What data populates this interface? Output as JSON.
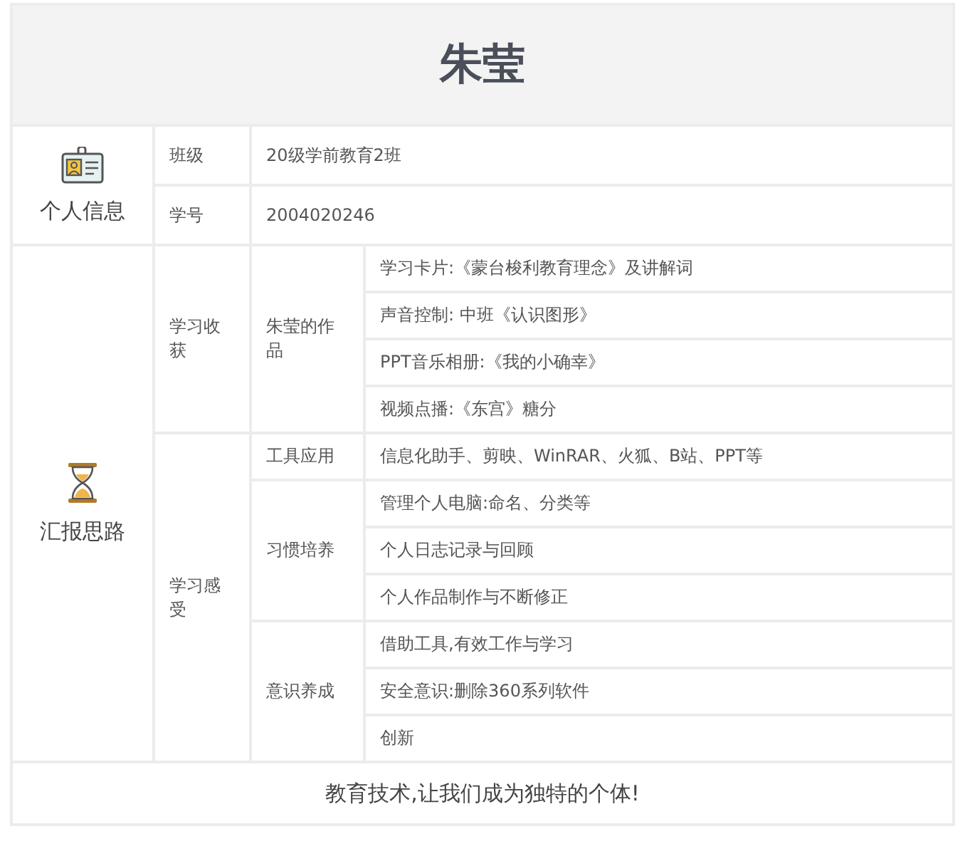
{
  "title": "朱莹",
  "sections": [
    {
      "kind": "info",
      "label": "个人信息",
      "rows": [
        {
          "label": "班级",
          "value": "20级学前教育2班"
        },
        {
          "label": "学号",
          "value": "2004020246"
        }
      ]
    },
    {
      "kind": "outline",
      "label": "汇报思路",
      "groups": [
        {
          "label": "学习收获",
          "subgroups": [
            {
              "label": "朱莹的作品",
              "items": [
                "学习卡片:《蒙台梭利教育理念》及讲解词",
                "声音控制: 中班《认识图形》",
                "PPT音乐相册:《我的小确幸》",
                "视频点播:《东宫》糖分"
              ]
            }
          ]
        },
        {
          "label": "学习感受",
          "subgroups": [
            {
              "label": "工具应用",
              "items": [
                "信息化助手、剪映、WinRAR、火狐、B站、PPT等"
              ]
            },
            {
              "label": "习惯培养",
              "items": [
                "管理个人电脑:命名、分类等",
                "个人日志记录与回顾",
                "个人作品制作与不断修正"
              ]
            },
            {
              "label": "意识养成",
              "items": [
                "借助工具,有效工作与学习",
                "安全意识:删除360系列软件",
                "创新"
              ]
            }
          ]
        }
      ]
    }
  ],
  "footer": "教育技术,让我们成为独特的个体!"
}
